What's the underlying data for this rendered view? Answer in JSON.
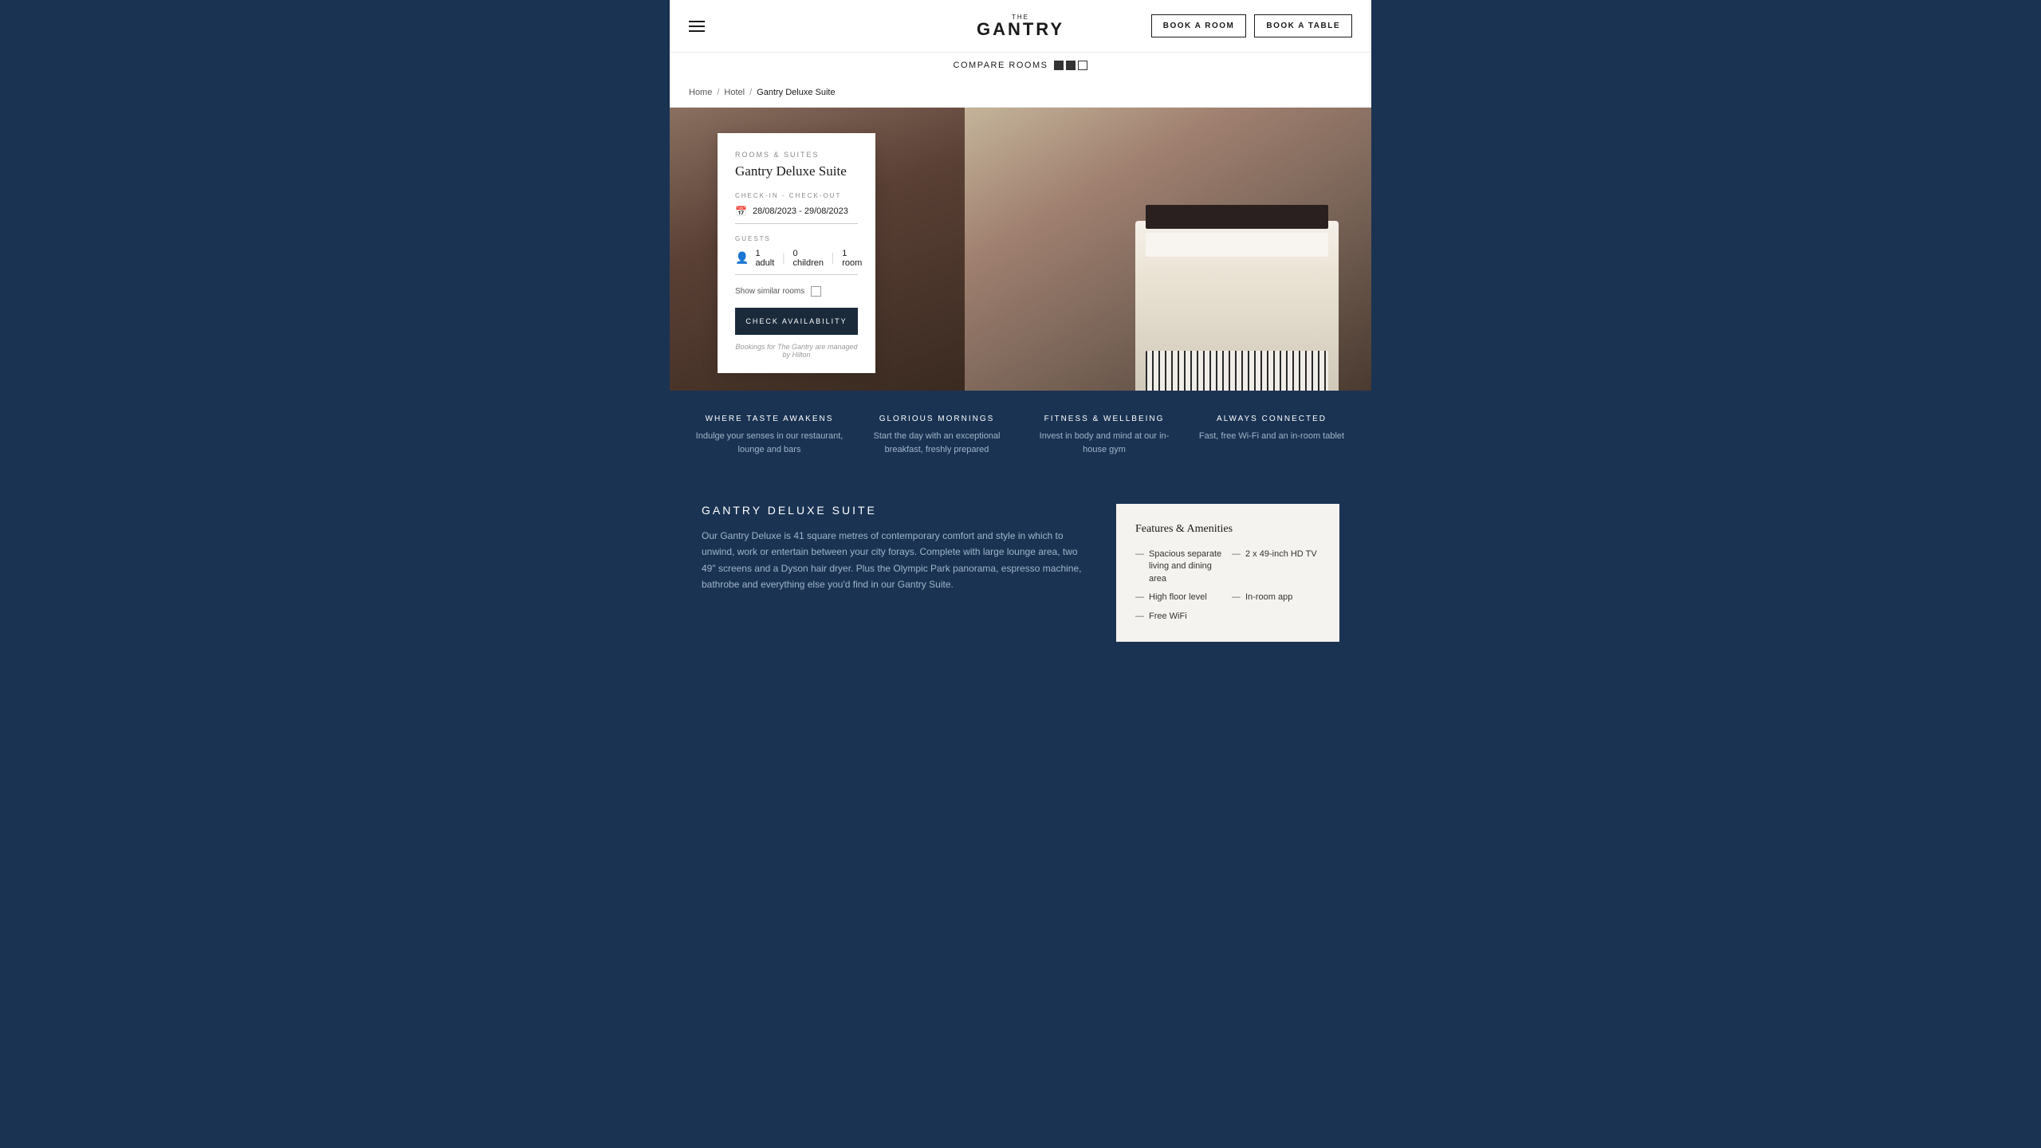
{
  "header": {
    "logo_the": "THE",
    "logo_main": "GANTRY",
    "book_room_label": "BOOK A ROOM",
    "book_table_label": "BOOK A TABLE"
  },
  "compare_bar": {
    "label": "COMPARE ROOMS"
  },
  "breadcrumb": {
    "home": "Home",
    "hotel": "Hotel",
    "current": "Gantry Deluxe Suite",
    "sep1": "/",
    "sep2": "/"
  },
  "booking_card": {
    "category": "ROOMS & SUITES",
    "title": "Gantry Deluxe Suite",
    "checkin_label": "CHECK-IN - CHECK-OUT",
    "date_value": "28/08/2023 - 29/08/2023",
    "guests_label": "GUESTS",
    "adults": "1 adult",
    "children": "0 children",
    "room": "1 room",
    "similar_label": "Show similar rooms",
    "check_btn": "CHECK AVAILABILITY",
    "note": "Bookings for The Gantry are managed by Hilton"
  },
  "features": [
    {
      "title": "WHERE TASTE AWAKENS",
      "desc": "Indulge your senses in our restaurant, lounge and bars"
    },
    {
      "title": "GLORIOUS MORNINGS",
      "desc": "Start the day with an exceptional breakfast, freshly prepared"
    },
    {
      "title": "FITNESS & WELLBEING",
      "desc": "Invest in body and mind at our in-house gym"
    },
    {
      "title": "ALWAYS CONNECTED",
      "desc": "Fast, free Wi-Fi and an in-room tablet"
    }
  ],
  "room_section": {
    "title": "GANTRY DELUXE SUITE",
    "description": "Our Gantry Deluxe is 41 square metres of contemporary comfort and style in which to unwind, work or entertain between your city forays. Complete with large lounge area, two 49\" screens and a Dyson hair dryer. Plus the Olympic Park panorama, espresso machine, bathrobe and everything else you'd find in our Gantry Suite."
  },
  "amenities": {
    "title": "Features & Amenities",
    "items_left": [
      "Spacious separate living and dining area",
      "High floor level"
    ],
    "items_right": [
      "2 x 49-inch HD TV",
      "In-room app",
      "Free WiFi"
    ]
  }
}
